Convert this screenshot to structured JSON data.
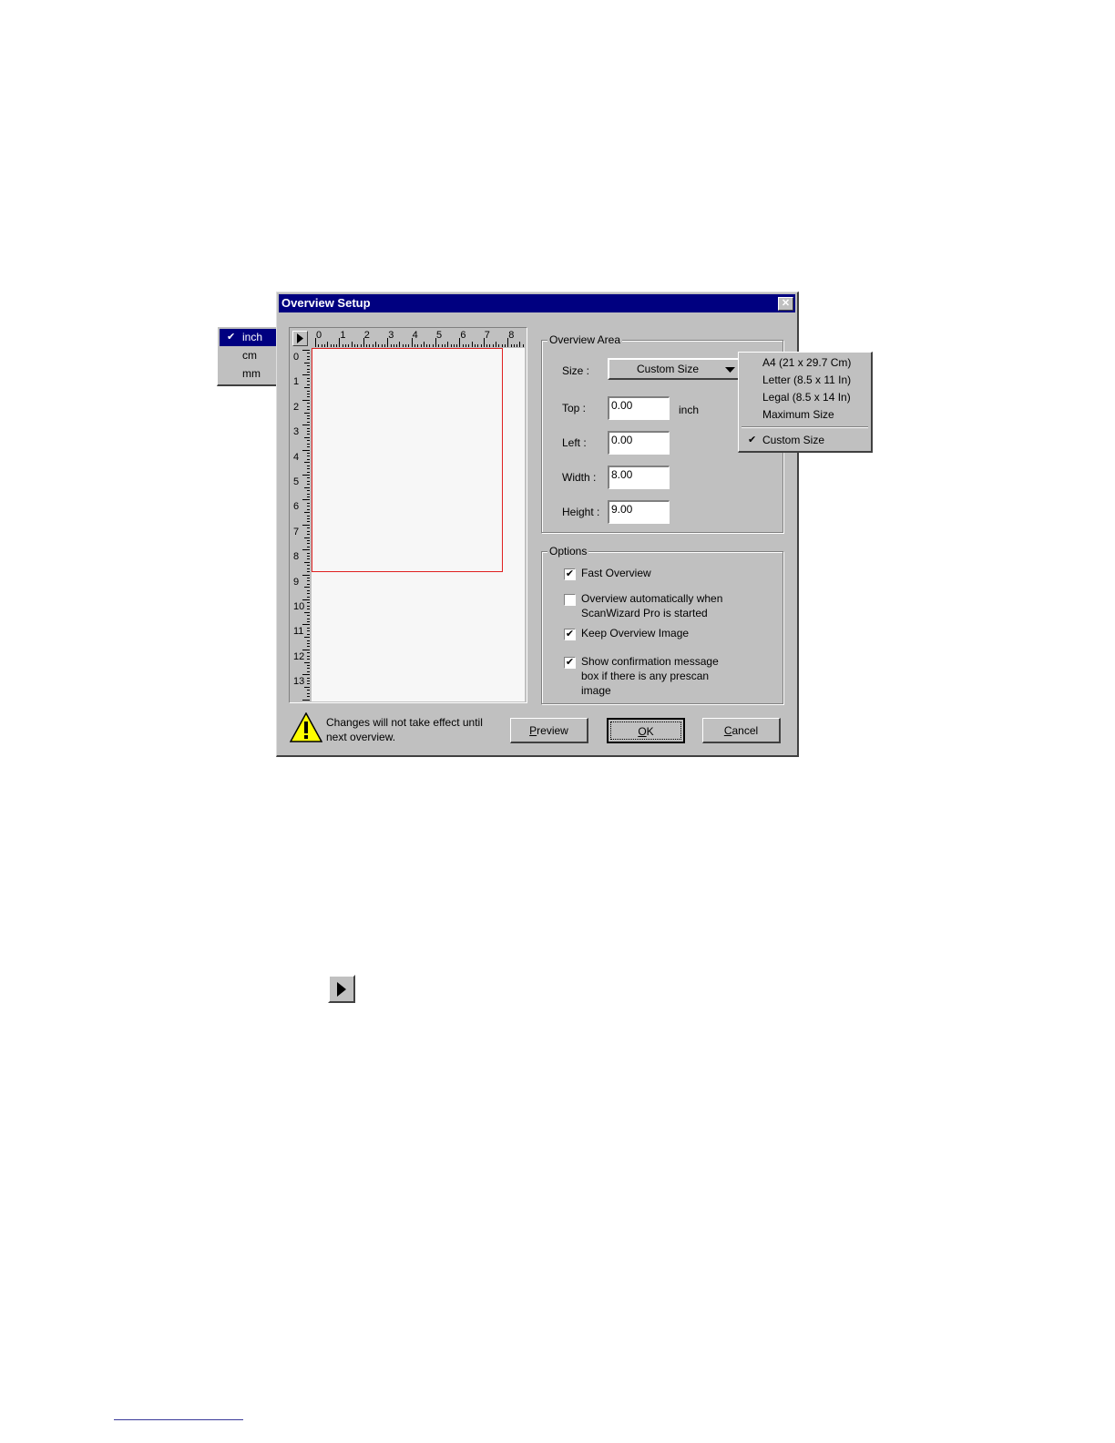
{
  "dialog": {
    "title": "Overview Setup",
    "close_symbol": "✕"
  },
  "units_menu": {
    "items": [
      {
        "label": "inch",
        "checked": true
      },
      {
        "label": "cm",
        "checked": false
      },
      {
        "label": "mm",
        "checked": false
      }
    ],
    "check_symbol": "✔"
  },
  "ruler": {
    "horizontal_labels": [
      "0",
      "1",
      "2",
      "3",
      "4",
      "5",
      "6",
      "7",
      "8"
    ],
    "vertical_labels": [
      "0",
      "1",
      "2",
      "3",
      "4",
      "5",
      "6",
      "7",
      "8",
      "9",
      "10",
      "11",
      "12",
      "13"
    ]
  },
  "overview_area": {
    "label": "Overview Area",
    "size_label": "Size :",
    "size_value": "Custom Size",
    "top_label": "Top :",
    "top_value": "0.00",
    "unit_label": "inch",
    "left_label": "Left :",
    "left_value": "0.00",
    "width_label": "Width :",
    "width_value": "8.00",
    "height_label": "Height :",
    "height_value": "9.00"
  },
  "size_menu": {
    "items": [
      {
        "label": "A4 (21 x 29.7 Cm)",
        "checked": false
      },
      {
        "label": "Letter (8.5 x 11 In)",
        "checked": false
      },
      {
        "label": "Legal (8.5 x 14 In)",
        "checked": false
      },
      {
        "label": "Maximum Size",
        "checked": false
      },
      {
        "label": "Custom Size",
        "checked": true
      }
    ]
  },
  "options": {
    "label": "Options",
    "fast_overview": {
      "line1": "Fast Overview",
      "checked": true
    },
    "auto_overview": {
      "line1": "Overview automatically when",
      "line2": "ScanWizard Pro is started",
      "checked": false
    },
    "keep_image": {
      "line1": "Keep Overview Image",
      "checked": true
    },
    "confirm_message": {
      "line1": "Show confirmation message",
      "line2": "box if there is any prescan",
      "line3": "image",
      "checked": true
    },
    "check_mark": "✔"
  },
  "footer": {
    "warning_line1": "Changes will not take effect until",
    "warning_line2": "next overview.",
    "preview_hotkey": "P",
    "preview_rest": "review",
    "ok_hotkey": "O",
    "ok_rest": "K",
    "cancel_hotkey": "C",
    "cancel_rest": "ancel"
  },
  "preview_region": {
    "width_in": 8.0,
    "height_in": 9.0,
    "border_color": "#e02020"
  },
  "colors": {
    "title_bar": "#000080",
    "dialog_face": "#c0c0c0",
    "selection": "#000080"
  }
}
